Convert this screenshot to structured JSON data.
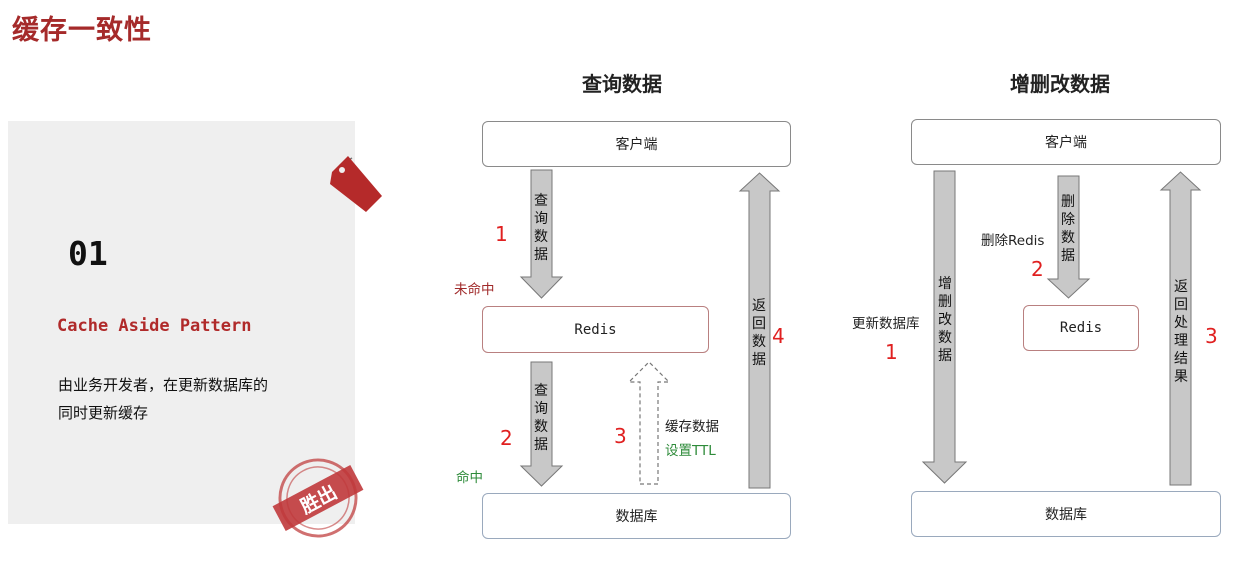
{
  "page_title": "缓存一致性",
  "card": {
    "number": "01",
    "pattern": "Cache Aside Pattern",
    "desc_line1": "由业务开发者，在更新数据库的",
    "desc_line2": "同时更新缓存",
    "stamp_text": "胜出"
  },
  "query": {
    "title": "查询数据",
    "client": "客户端",
    "redis": "Redis",
    "db": "数据库",
    "arrow1_text": "查询数据",
    "arrow2_text": "查询数据",
    "return_text": "返回数据",
    "miss": "未命中",
    "hit": "命中",
    "cache_line1": "缓存数据",
    "cache_line2": "设置TTL",
    "n1": "1",
    "n2": "2",
    "n3": "3",
    "n4": "4"
  },
  "update": {
    "title": "增删改数据",
    "client": "客户端",
    "redis": "Redis",
    "db": "数据库",
    "update_arrow_text": "增删改数据",
    "delete_arrow_text": "删除数据",
    "return_text": "返回处理结果",
    "update_db_label": "更新数据库",
    "delete_redis_label": "删除Redis",
    "n1": "1",
    "n2": "2",
    "n3": "3"
  },
  "colors": {
    "title_red": "#a52a2a",
    "number_red": "#e02020",
    "hit_green": "#2e8b3a",
    "arrow_fill": "#c8c8c8",
    "tag_red": "#b52a2a"
  }
}
